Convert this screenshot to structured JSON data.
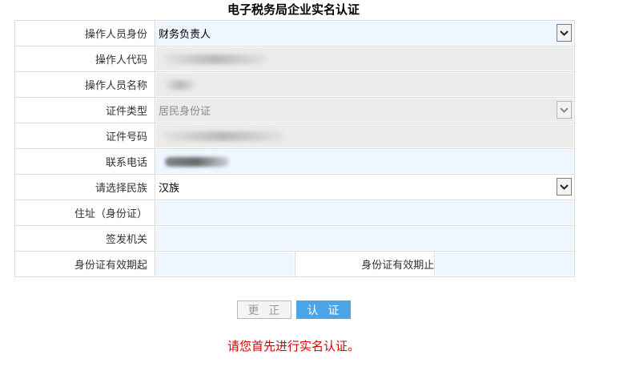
{
  "title": "电子税务局企业实名认证",
  "rows": [
    {
      "label": "操作人员身份",
      "value": "财务负责人"
    },
    {
      "label": "操作人代码",
      "value": ""
    },
    {
      "label": "操作人员名称",
      "value": ""
    },
    {
      "label": "证件类型",
      "value": "居民身份证"
    },
    {
      "label": "证件号码",
      "value": ""
    },
    {
      "label": "联系电话",
      "value": ""
    },
    {
      "label": "请选择民族",
      "value": "汉族"
    },
    {
      "label": "住址（身份证）",
      "value": ""
    },
    {
      "label": "签发机关",
      "value": ""
    }
  ],
  "validity": {
    "start_label": "身份证有效期起",
    "start_value": "",
    "end_label": "身份证有效期止",
    "end_value": ""
  },
  "buttons": {
    "modify_label": "更正",
    "verify_label": "认证"
  },
  "notice": "请您首先进行实名认证。",
  "colors": {
    "notice": "#dd0000",
    "primary_button": "#4aa4e8",
    "input_blue": "#eef6ff",
    "input_gray": "#ebebeb"
  }
}
